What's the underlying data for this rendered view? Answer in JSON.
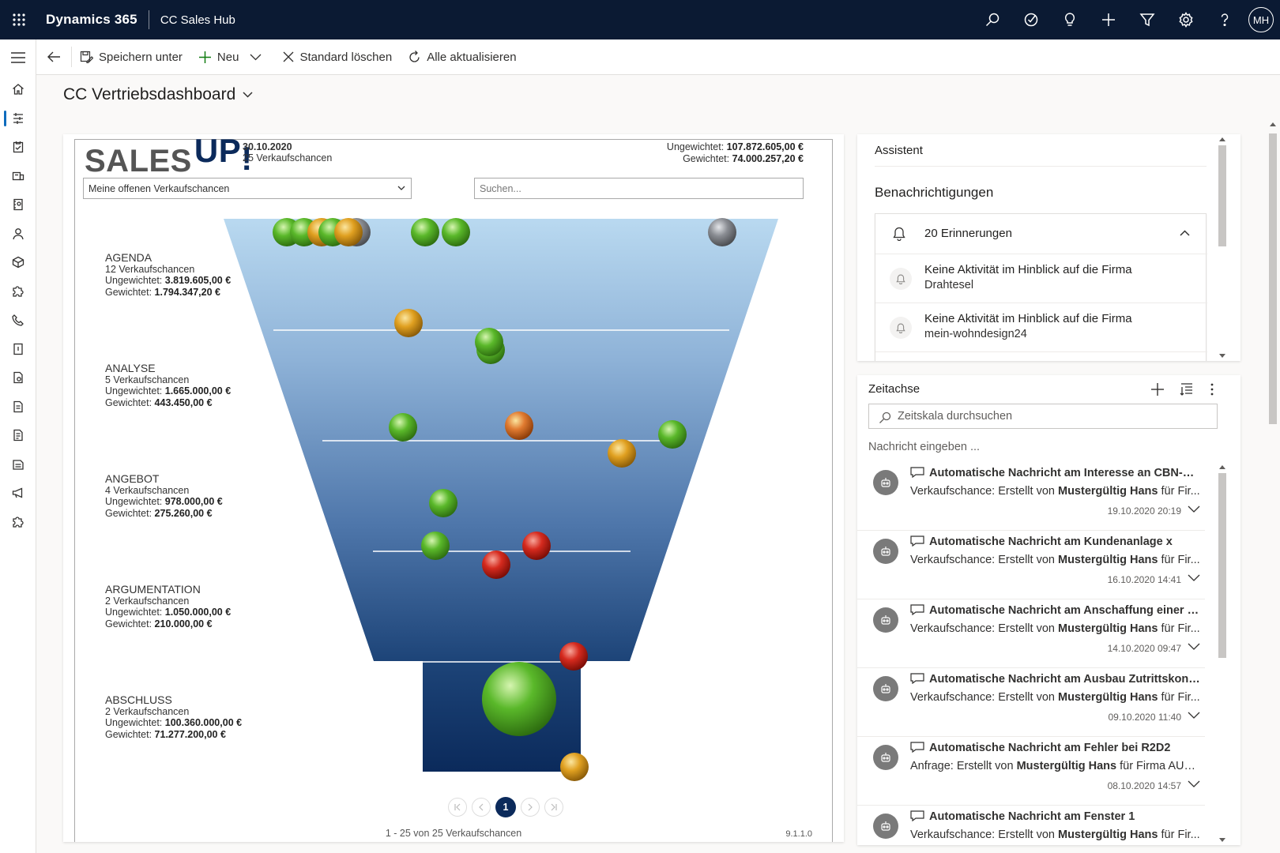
{
  "topbar": {
    "brand": "Dynamics 365",
    "app": "CC Sales Hub",
    "user_initials": "MH",
    "icons": [
      "search-icon",
      "task-icon",
      "lightbulb-icon",
      "plus-icon",
      "filter-icon",
      "gear-icon",
      "help-icon"
    ]
  },
  "commands": {
    "save_as": "Speichern unter",
    "new": "Neu",
    "clear_default": "Standard löschen",
    "refresh_all": "Alle aktualisieren"
  },
  "dashboard": {
    "title": "CC Vertriebsdashboard"
  },
  "salesup": {
    "logo_sales": "SALES",
    "logo_up": "UP",
    "logo_excl": "!",
    "date": "30.10.2020",
    "count": "25 Verkaufschancen",
    "unweighted_label": "Ungewichtet:",
    "unweighted_value": "107.872.605,00 €",
    "weighted_label": "Gewichtet:",
    "weighted_value": "74.000.257,20 €",
    "filter": "Meine offenen Verkaufschancen",
    "search_placeholder": "Suchen...",
    "stages": [
      {
        "name": "AGENDA",
        "count": "12 Verkaufschancen",
        "unw_label": "Ungewichtet:",
        "unw": "3.819.605,00 €",
        "w_label": "Gewichtet:",
        "w": "1.794.347,20 €"
      },
      {
        "name": "ANALYSE",
        "count": "5 Verkaufschancen",
        "unw_label": "Ungewichtet:",
        "unw": "1.665.000,00 €",
        "w_label": "Gewichtet:",
        "w": "443.450,00 €"
      },
      {
        "name": "ANGEBOT",
        "count": "4 Verkaufschancen",
        "unw_label": "Ungewichtet:",
        "unw": "978.000,00 €",
        "w_label": "Gewichtet:",
        "w": "275.260,00 €"
      },
      {
        "name": "ARGUMENTATION",
        "count": "2 Verkaufschancen",
        "unw_label": "Ungewichtet:",
        "unw": "1.050.000,00 €",
        "w_label": "Gewichtet:",
        "w": "210.000,00 €"
      },
      {
        "name": "ABSCHLUSS",
        "count": "2 Verkaufschancen",
        "unw_label": "Ungewichtet:",
        "unw": "100.360.000,00 €",
        "w_label": "Gewichtet:",
        "w": "71.277.200,00 €"
      }
    ],
    "page": "1",
    "page_text": "1 - 25 von 25 Verkaufschancen",
    "version": "9.1.1.0"
  },
  "assistant": {
    "title": "Assistent",
    "notifications": "Benachrichtigungen",
    "reminders": "20 Erinnerungen",
    "items": [
      {
        "title": "Keine Aktivität im Hinblick auf die Firma",
        "sub": "Drahtesel"
      },
      {
        "title": "Keine Aktivität im Hinblick auf die Firma",
        "sub": "mein-wohndesign24"
      }
    ]
  },
  "timeline": {
    "title": "Zeitachse",
    "search_placeholder": "Zeitskala durchsuchen",
    "message_placeholder": "Nachricht eingeben ...",
    "items": [
      {
        "title": "Automatische Nachricht am Interesse an CBN-Werk...",
        "pre": "Verkaufschance: Erstellt von ",
        "author": "Mustergültig Hans",
        "post": " für Fir...",
        "date": "19.10.2020 20:19"
      },
      {
        "title": "Automatische Nachricht am Kundenanlage x",
        "pre": "Verkaufschance: Erstellt von ",
        "author": "Mustergültig Hans",
        "post": " für Fir...",
        "date": "16.10.2020 14:41"
      },
      {
        "title": "Automatische Nachricht am Anschaffung einer neu...",
        "pre": "Verkaufschance: Erstellt von ",
        "author": "Mustergültig Hans",
        "post": " für Fir...",
        "date": "14.10.2020 09:47"
      },
      {
        "title": "Automatische Nachricht am Ausbau Zutrittskontrolle",
        "pre": "Verkaufschance: Erstellt von ",
        "author": "Mustergültig Hans",
        "post": " für Fir...",
        "date": "09.10.2020 11:40"
      },
      {
        "title": "Automatische Nachricht am Fehler bei R2D2",
        "pre": "Anfrage: Erstellt von ",
        "author": "Mustergültig Hans",
        "post": " für Firma AUDI...",
        "date": "08.10.2020 14:57"
      },
      {
        "title": "Automatische Nachricht am Fenster 1",
        "pre": "Verkaufschance: Erstellt von ",
        "author": "Mustergültig Hans",
        "post": " für Fir...",
        "date": ""
      }
    ]
  },
  "colors": {
    "topbar": "#0b1a33",
    "accent": "#0f6cbd",
    "funnel_top": "#b9d9f0",
    "funnel_bottom": "#0b2a5b",
    "ball_green": "#5ab82a",
    "ball_orange": "#e0a020",
    "ball_red": "#d52a1e",
    "ball_gray": "#8a8d93"
  }
}
